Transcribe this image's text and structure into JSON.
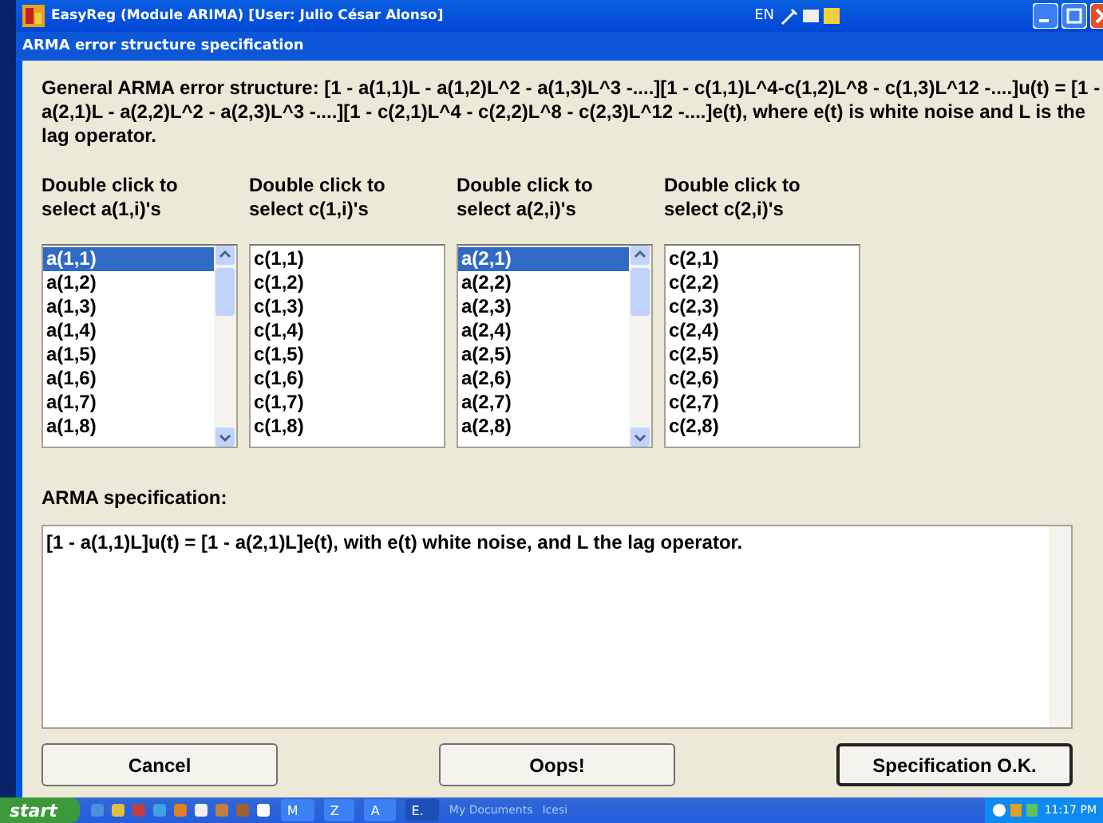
{
  "window": {
    "title": "EasyReg (Module ARIMA) [User: Julio César Alonso]",
    "language": "EN"
  },
  "dialog": {
    "title": "ARMA error structure specification",
    "description": "General ARMA error structure: [1 - a(1,1)L - a(1,2)L^2 - a(1,3)L^3 -....][1 - c(1,1)L^4-c(1,2)L^8 - c(1,3)L^12 -....]u(t) = [1 - a(2,1)L - a(2,2)L^2 - a(2,3)L^3 -....][1 - c(2,1)L^4 - c(2,2)L^8 - c(2,3)L^12 -....]e(t), where e(t) is white noise and L is the lag operator.",
    "lists": [
      {
        "heading": "Double click to select a(1,i)'s",
        "scrollable": true,
        "items": [
          {
            "label": "a(1,1)",
            "selected": true
          },
          {
            "label": "a(1,2)",
            "selected": false
          },
          {
            "label": "a(1,3)",
            "selected": false
          },
          {
            "label": "a(1,4)",
            "selected": false
          },
          {
            "label": "a(1,5)",
            "selected": false
          },
          {
            "label": "a(1,6)",
            "selected": false
          },
          {
            "label": "a(1,7)",
            "selected": false
          },
          {
            "label": "a(1,8)",
            "selected": false
          }
        ]
      },
      {
        "heading": "Double click to select c(1,i)'s",
        "scrollable": false,
        "items": [
          {
            "label": "c(1,1)",
            "selected": false
          },
          {
            "label": "c(1,2)",
            "selected": false
          },
          {
            "label": "c(1,3)",
            "selected": false
          },
          {
            "label": "c(1,4)",
            "selected": false
          },
          {
            "label": "c(1,5)",
            "selected": false
          },
          {
            "label": "c(1,6)",
            "selected": false
          },
          {
            "label": "c(1,7)",
            "selected": false
          },
          {
            "label": "c(1,8)",
            "selected": false
          }
        ]
      },
      {
        "heading": "Double click to select a(2,i)'s",
        "scrollable": true,
        "items": [
          {
            "label": "a(2,1)",
            "selected": true
          },
          {
            "label": "a(2,2)",
            "selected": false
          },
          {
            "label": "a(2,3)",
            "selected": false
          },
          {
            "label": "a(2,4)",
            "selected": false
          },
          {
            "label": "a(2,5)",
            "selected": false
          },
          {
            "label": "a(2,6)",
            "selected": false
          },
          {
            "label": "a(2,7)",
            "selected": false
          },
          {
            "label": "a(2,8)",
            "selected": false
          }
        ]
      },
      {
        "heading": "Double click to select c(2,i)'s",
        "scrollable": false,
        "items": [
          {
            "label": "c(2,1)",
            "selected": false
          },
          {
            "label": "c(2,2)",
            "selected": false
          },
          {
            "label": "c(2,3)",
            "selected": false
          },
          {
            "label": "c(2,4)",
            "selected": false
          },
          {
            "label": "c(2,5)",
            "selected": false
          },
          {
            "label": "c(2,6)",
            "selected": false
          },
          {
            "label": "c(2,7)",
            "selected": false
          },
          {
            "label": "c(2,8)",
            "selected": false
          }
        ]
      }
    ],
    "spec_label": "ARMA specification:",
    "spec_value": "[1 - a(1,1)L]u(t) = [1 - a(2,1)L]e(t), with e(t) white noise, and L the lag operator.",
    "buttons": [
      "Cancel",
      "Oops!",
      "Specification O.K."
    ]
  },
  "taskbar": {
    "start": "start",
    "tasks": [
      {
        "label": "M",
        "selected": false
      },
      {
        "label": "Z",
        "selected": false
      },
      {
        "label": "A",
        "selected": false
      },
      {
        "label": "E.",
        "selected": true
      }
    ],
    "toolbars": [
      "My Documents",
      "Icesi"
    ],
    "clock": "11:17 PM"
  }
}
